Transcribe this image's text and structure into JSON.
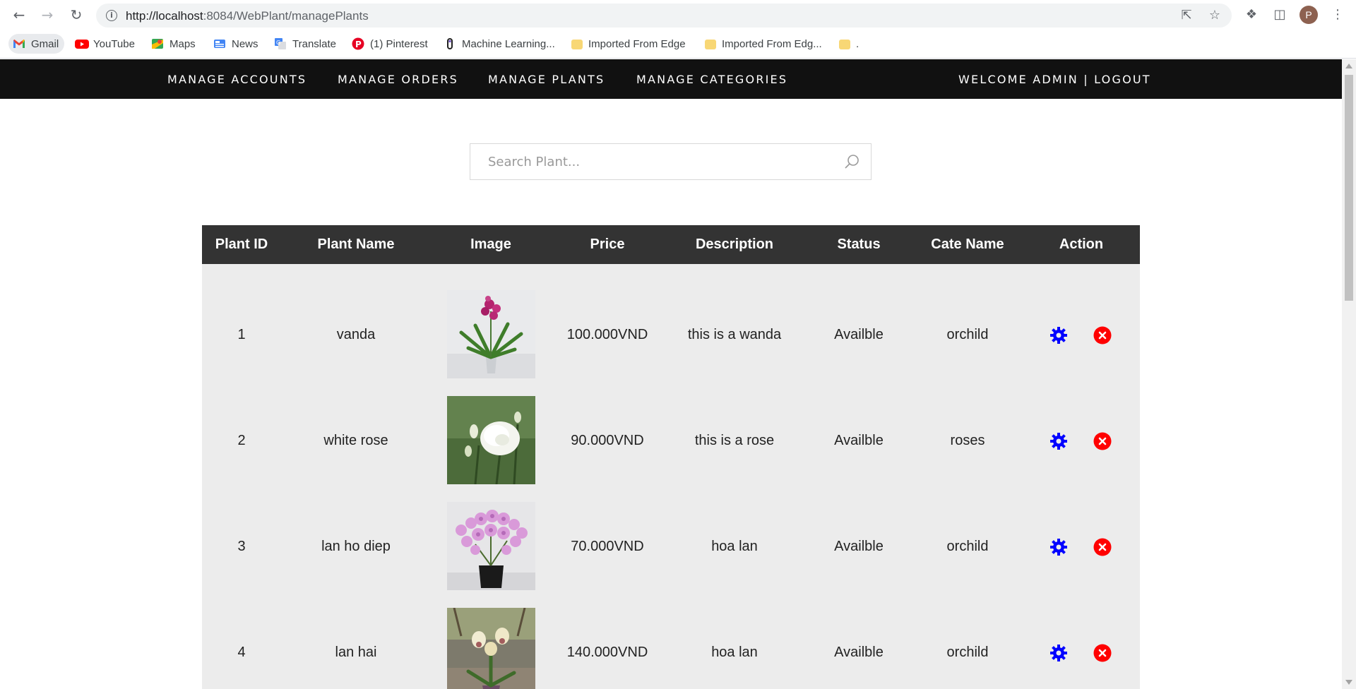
{
  "browser": {
    "url_host": "http://localhost",
    "url_rest": ":8084/WebPlant/managePlants",
    "profile_initial": "P",
    "bookmarks": [
      {
        "label": "Gmail",
        "icon": "gmail-icon"
      },
      {
        "label": "YouTube",
        "icon": "youtube-icon"
      },
      {
        "label": "Maps",
        "icon": "maps-icon"
      },
      {
        "label": "News",
        "icon": "news-icon"
      },
      {
        "label": "Translate",
        "icon": "translate-icon"
      },
      {
        "label": "(1) Pinterest",
        "icon": "pinterest-icon"
      },
      {
        "label": "Machine Learning...",
        "icon": "ml-icon"
      },
      {
        "label": "Imported From Edge",
        "icon": "folder-icon"
      },
      {
        "label": "Imported From Edg...",
        "icon": "folder-icon"
      },
      {
        "label": ".",
        "icon": "folder-icon"
      }
    ]
  },
  "nav": {
    "items": [
      "MANAGE ACCOUNTS",
      "MANAGE ORDERS",
      "MANAGE PLANTS",
      "MANAGE CATEGORIES"
    ],
    "user": "WELCOME ADMIN | LOGOUT"
  },
  "search": {
    "placeholder": "Search Plant..."
  },
  "table": {
    "headers": [
      "Plant ID",
      "Plant Name",
      "Image",
      "Price",
      "Description",
      "Status",
      "Cate Name",
      "Action"
    ],
    "rows": [
      {
        "id": "1",
        "name": "vanda",
        "price": "100.000VND",
        "description": "this is a wanda",
        "status": "Availble",
        "category": "orchild",
        "image": "purple-vanda-orchid-in-glass-vase"
      },
      {
        "id": "2",
        "name": "white rose",
        "price": "90.000VND",
        "description": "this is a rose",
        "status": "Availble",
        "category": "roses",
        "image": "white-rose-with-buds"
      },
      {
        "id": "3",
        "name": "lan ho diep",
        "price": "70.000VND",
        "description": "hoa lan",
        "status": "Availble",
        "category": "orchild",
        "image": "pink-phalaenopsis-in-black-pot"
      },
      {
        "id": "4",
        "name": "lan hai",
        "price": "140.000VND",
        "description": "hoa lan",
        "status": "Availble",
        "category": "orchild",
        "image": "paphiopedilum-orchid-in-pot"
      }
    ]
  },
  "colors": {
    "nav_bg": "#111111",
    "table_header_bg": "#333333",
    "table_body_bg": "#ececec",
    "edit_icon": "#0000ff",
    "delete_icon": "#ff0000"
  }
}
